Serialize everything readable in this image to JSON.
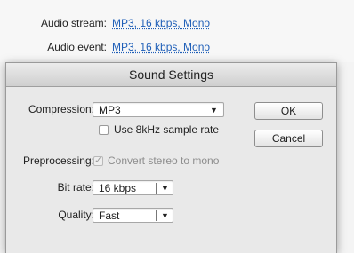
{
  "background": {
    "audio_stream_label": "Audio stream:",
    "audio_stream_value": "MP3, 16 kbps, Mono",
    "audio_event_label": "Audio event:",
    "audio_event_value": "MP3, 16 kbps, Mono"
  },
  "dialog": {
    "title": "Sound Settings",
    "compression_label": "Compression:",
    "compression_value": "MP3",
    "use_8khz_label": "Use 8kHz sample rate",
    "use_8khz_checked": false,
    "ok_label": "OK",
    "cancel_label": "Cancel",
    "preprocessing_label": "Preprocessing:",
    "convert_stereo_label": "Convert stereo to mono",
    "convert_stereo_checked": true,
    "convert_stereo_enabled": false,
    "bitrate_label": "Bit rate:",
    "bitrate_value": "16 kbps",
    "quality_label": "Quality:",
    "quality_value": "Fast"
  },
  "colors": {
    "link": "#1f5fb8",
    "dialog_bg": "#e9e9e9",
    "disabled_text": "#8d8d8d"
  },
  "icons": {
    "dropdown_arrow": "chevron-down-icon",
    "checkmark": "checkmark-icon"
  }
}
